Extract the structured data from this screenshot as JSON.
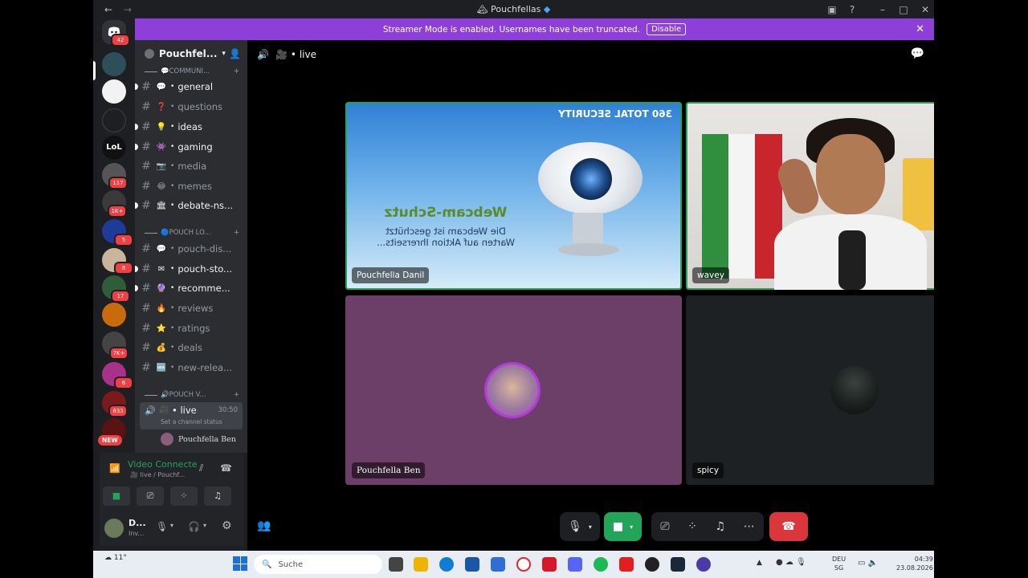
{
  "window": {
    "title": "Pouchfellas",
    "title_icon": "gem-icon"
  },
  "banner": {
    "text": "Streamer Mode is enabled. Usernames have been truncated.",
    "disable_label": "Disable"
  },
  "servers": {
    "home_badge": "42",
    "badges": [
      "117",
      "1K+",
      "5",
      "8",
      "17",
      "7K+",
      "6",
      "833"
    ],
    "new_label": "NEW",
    "lol_label": "LoL"
  },
  "guild": {
    "name": "Pouchfel..."
  },
  "categories": {
    "communi": "COMMUNI...",
    "pouch_lo": "POUCH LO...",
    "pouch_v": "POUCH V..."
  },
  "channels": [
    {
      "name": "general",
      "emoji": "💬",
      "unread": true
    },
    {
      "name": "questions",
      "emoji": "❓",
      "unread": false
    },
    {
      "name": "ideas",
      "emoji": "💡",
      "unread": true
    },
    {
      "name": "gaming",
      "emoji": "👾",
      "unread": true
    },
    {
      "name": "media",
      "emoji": "📷",
      "unread": false
    },
    {
      "name": "memes",
      "emoji": "😂",
      "unread": false
    },
    {
      "name": "debate-ns...",
      "emoji": "🏛",
      "unread": true
    },
    {
      "name": "pouch-dis...",
      "emoji": "💬",
      "unread": false
    },
    {
      "name": "pouch-sto...",
      "emoji": "✉",
      "unread": true
    },
    {
      "name": "recomme...",
      "emoji": "🔮",
      "unread": true
    },
    {
      "name": "reviews",
      "emoji": "🔥",
      "unread": false
    },
    {
      "name": "ratings",
      "emoji": "⭐",
      "unread": false
    },
    {
      "name": "deals",
      "emoji": "💰",
      "unread": false
    },
    {
      "name": "new-relea...",
      "emoji": "🆕",
      "unread": false
    }
  ],
  "voice_channel": {
    "name": "live",
    "timer": "30:50",
    "status_hint": "Set a channel status",
    "member": "Pouchfella Ben"
  },
  "voice_panel": {
    "status": "Video Connecte",
    "location": "live / Pouchf..."
  },
  "user_panel": {
    "name": "D...",
    "status": "Inv..."
  },
  "main_header": {
    "channel": "live"
  },
  "tiles": [
    {
      "name": "Pouchfella Danil",
      "speaking": true,
      "webcam_brand": "360 TOTAL SECURITY",
      "webcam_title": "Webcam-Schutz",
      "webcam_line1": "Die Webcam ist geschützt",
      "webcam_line2": "Warten auf Aktion Ihrerseits..."
    },
    {
      "name": "wavey",
      "speaking": true
    },
    {
      "name": "Pouchfella Ben",
      "speaking": false,
      "bg": "#6b3f67"
    },
    {
      "name": "spicy",
      "speaking": false,
      "bg": "#1e2124"
    }
  ],
  "taskbar": {
    "search_placeholder": "Suche",
    "weather": "11°",
    "lang1": "DEU",
    "lang2": "SG",
    "time": "04:39",
    "date": "23.08.2026"
  },
  "colors": {
    "accent": "#8f3fd9",
    "speaking": "#23a559",
    "danger": "#da373c",
    "video_on": "#23a559"
  }
}
